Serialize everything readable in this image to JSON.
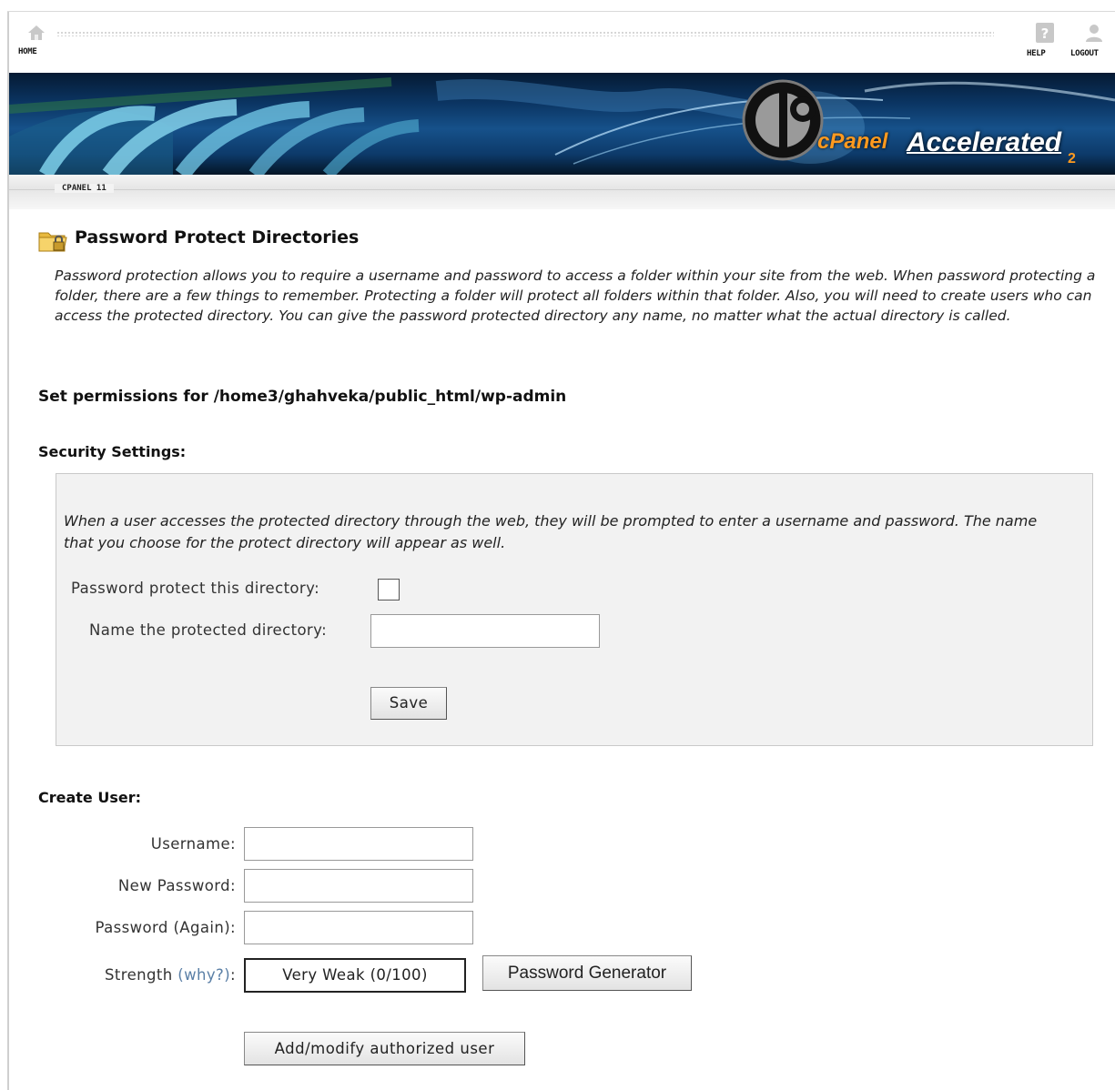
{
  "nav": {
    "home_label": "HOME",
    "help_label": "HELP",
    "logout_label": "LOGOUT"
  },
  "banner": {
    "brand": "cPanel",
    "product": "Accelerated",
    "product_suffix": "2"
  },
  "version_label": "CPANEL 11",
  "page": {
    "title": "Password Protect Directories",
    "intro": "Password protection allows you to require a username and password to access a folder within your site from the web. When password protecting a folder, there are a few things to remember. Protecting a folder will protect all folders within that folder. Also, you will need to create users who can access the protected directory. You can give the password protected directory any name, no matter what the actual directory is called.",
    "permissions_heading": "Set permissions for /home3/ghahveka/public_html/wp-admin"
  },
  "security": {
    "heading": "Security Settings:",
    "note": "When a user accesses the protected directory through the web, they will be prompted to enter a username and password. The name that you choose for the protect directory will appear as well.",
    "protect_label": "Password protect this directory:",
    "name_label": "Name the protected directory:",
    "name_value": "",
    "save_label": "Save"
  },
  "create_user": {
    "heading": "Create User:",
    "username_label": "Username:",
    "new_password_label": "New Password:",
    "password_again_label": "Password (Again):",
    "strength_label": "Strength",
    "why_link": "(why?)",
    "strength_colon": ":",
    "strength_value": "Very Weak (0/100)",
    "generator_label": "Password Generator",
    "submit_label": "Add/modify authorized user"
  },
  "colors": {
    "accent_orange": "#ff9a1f",
    "link_blue": "#5a7fa6",
    "panel_bg": "#f2f2f2"
  }
}
